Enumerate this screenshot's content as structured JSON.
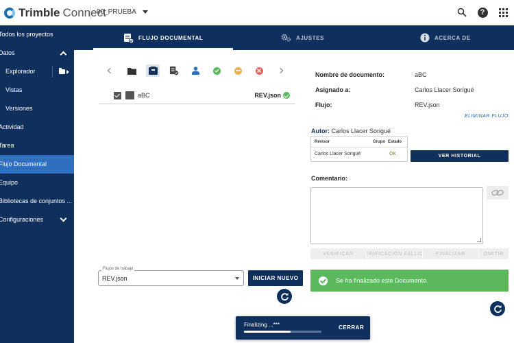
{
  "topbar": {
    "brand": "Trimble",
    "product": "Connect",
    "project": "00_PRUEBA",
    "icons": [
      "search-icon",
      "help-icon",
      "apps-grid-icon"
    ],
    "help_glyph": "?"
  },
  "sidebar": {
    "items": [
      {
        "label": "Todos los proyectos"
      },
      {
        "label": "Datos"
      },
      {
        "label": "Explorador"
      },
      {
        "label": "Vistas"
      },
      {
        "label": "Versiones"
      },
      {
        "label": "Actividad"
      },
      {
        "label": "Tarea"
      },
      {
        "label": "Flujo Documental"
      },
      {
        "label": "Equipo"
      },
      {
        "label": "Bibliotecas de conjuntos ..."
      },
      {
        "label": "Configuraciones"
      }
    ],
    "active": "Flujo Documental"
  },
  "tabs": [
    {
      "label": "FLUJO DOCUMENTAL",
      "icon": "workflow-doc-icon"
    },
    {
      "label": "AJUSTES",
      "icon": "gears-icon"
    },
    {
      "label": "ACERCA DE",
      "icon": "info-icon"
    }
  ],
  "documents": [
    {
      "name": "aBC",
      "revision": "REV.json",
      "checked": true
    }
  ],
  "details": {
    "doc_name_label": "Nombre de documento:",
    "doc_name_value": "aBC",
    "assigned_label": "Asignado a:",
    "assigned_value": "Carlos Llacer Sorigué",
    "flow_label": "Flujo:",
    "flow_value": "REV.json",
    "delete_flow": "ELIMINAR FLUJO",
    "author_label": "Autor:",
    "author_value": "Carlos Llacer Sorigué",
    "review_table": {
      "headers": [
        "Revisor",
        "Grupo",
        "Estado"
      ],
      "rows": [
        {
          "revisor": "Carlos Llacer Sorigué",
          "grupo": "",
          "estado": "OK"
        }
      ]
    },
    "history_button": "VER HISTORIAL",
    "comment_label": "Comentario:",
    "comment_value": "",
    "actions": [
      "VERIFICAR",
      "VERIFICACIÓN FALLIDA",
      "FINALIZAR",
      "OMITIR"
    ]
  },
  "workflow": {
    "legend": "Flujos de trabajo",
    "value": "REV.json",
    "start_button": "INICIAR NUEVO"
  },
  "success_message": "Se ha finalizado este Documento.",
  "snackbar": {
    "text": "Finalizing ...***",
    "progress": 0.6,
    "close_label": "CERRAR"
  },
  "colors": {
    "navy": "#0f2f5c",
    "active_blue": "#2f6fc0",
    "success": "#5cb85c",
    "warning": "#f0ad4e",
    "danger": "#e8615a"
  }
}
